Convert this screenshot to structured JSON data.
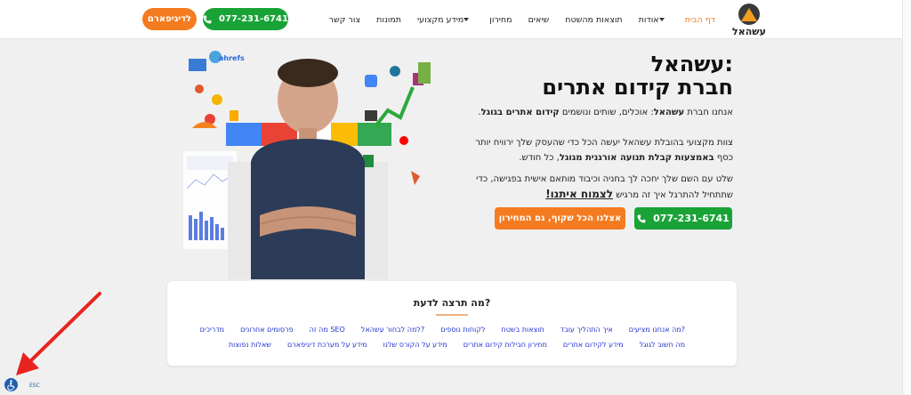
{
  "header": {
    "logo_text": "עשהאל",
    "nav": [
      {
        "label": "דף הבית",
        "active": true,
        "dropdown": false
      },
      {
        "label": "אודות",
        "active": false,
        "dropdown": true
      },
      {
        "label": "תוצאות מהשטח",
        "active": false,
        "dropdown": false
      },
      {
        "label": "שיאים",
        "active": false,
        "dropdown": false
      },
      {
        "label": "מחירון",
        "active": false,
        "dropdown": false
      },
      {
        "label": "מידע מקצועי",
        "active": false,
        "dropdown": true
      },
      {
        "label": "תמונות",
        "active": false,
        "dropdown": false
      },
      {
        "label": "צור קשר",
        "active": false,
        "dropdown": false
      }
    ],
    "phone_button": "077-231-6741",
    "whatsapp_button": "לדיגיפארם"
  },
  "hero": {
    "title_line1": "עשהאל:",
    "title_line2": "חברת קידום אתרים",
    "p1_a": "אנחנו חברת ",
    "p1_b": "עשהאל",
    "p1_c": ": אוכלים, שותים ונושמים ",
    "p1_d": "קידום אתרים בגוגל",
    "p1_e": ".",
    "p2_a": "צוות מקצועי בהובלת עשהאל יעשה הכל כדי שהעסק שלך ירוויח יותר כסף ",
    "p2_b": "באמצעות קבלת תנועה אורגנית מגוגל",
    "p2_c": ", כל חודש.",
    "p3_a": "שלט עם השם שלך יחכה לך בחניה וכיבוד מותאם אישית בפגישה, כדי שתתחיל להתרגל איך זה מרגיש ",
    "p3_link": "לצמוח איתנו!",
    "phone_button": "077-231-6741",
    "price_button": "אצלנו הכל שקוף, גם המחירון"
  },
  "info_card": {
    "title": "מה תרצה לדעת?",
    "row1": [
      "מה אנחנו מציעים?",
      "איך התהליך עובד",
      "תוצאות בשטח",
      "לקוחות נוספים",
      "למה לבחור עשהאל?",
      "מה זה SEO",
      "פרסומים אחרונים",
      "מדריכים"
    ],
    "row2": [
      "מה חשוב לגוגל",
      "מידע לקידום אתרים",
      "מחירון חבילות קידום אתרים",
      "מידע על הקורס שלנו",
      "מידע על מערכת דיגיפארם",
      "שאלות נפוצות"
    ]
  },
  "accessibility": {
    "label": "ESC"
  },
  "colors": {
    "accent": "#f47b20",
    "green": "#19a337",
    "link": "#2233cc",
    "arrow": "#e8231e"
  }
}
